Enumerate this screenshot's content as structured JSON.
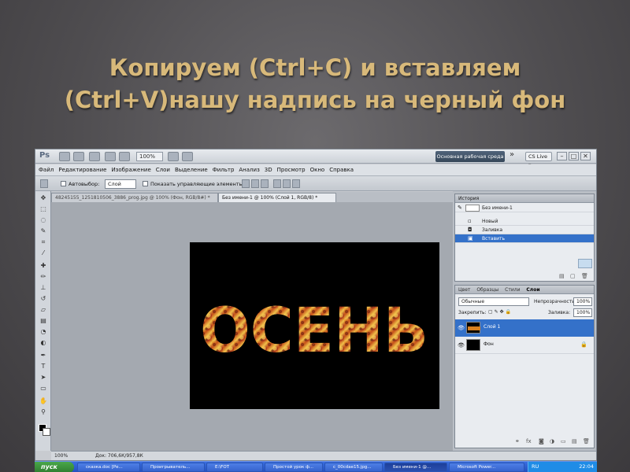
{
  "slide": {
    "title_line1": "Копируем (Ctrl+C) и вставляем",
    "title_line2": "(Ctrl+V)нашу надпись на черный фон"
  },
  "app": {
    "logo": "Ps",
    "zoom": "100%",
    "workspace": "Основная рабочая среда",
    "expand": "»",
    "cs_live": "CS Live ▾",
    "window_buttons": [
      "–",
      "□",
      "✕"
    ]
  },
  "menu": [
    "Файл",
    "Редактирование",
    "Изображение",
    "Слои",
    "Выделение",
    "Фильтр",
    "Анализ",
    "3D",
    "Просмотр",
    "Окно",
    "Справка"
  ],
  "options": {
    "auto_select_label": "Автовыбор:",
    "auto_select_value": "Слой",
    "show_controls_label": "Показать управляющие элементы"
  },
  "tabs": [
    {
      "label": "48245155_1251810506_3886_prog.jpg @ 100% (Фон, RGB/8#) *",
      "active": false
    },
    {
      "label": "Без имени-1 @ 100% (Слой 1, RGB/8) *",
      "active": true
    }
  ],
  "canvas": {
    "word": "ОСЕНЬ",
    "background": "#000000"
  },
  "status": {
    "zoom": "100%",
    "doc_size": "Док: 706,6К/957,8К"
  },
  "history": {
    "header": "История",
    "items": [
      {
        "label": "Без имени-1",
        "kind": "snapshot",
        "selected": false
      },
      {
        "label": "Новый",
        "kind": "step",
        "selected": false
      },
      {
        "label": "Заливка",
        "kind": "step",
        "selected": false
      },
      {
        "label": "Вставить",
        "kind": "step",
        "selected": true
      }
    ]
  },
  "layers": {
    "tabs": [
      "Цвет",
      "Образцы",
      "Стили",
      "Слои"
    ],
    "blend_mode": "Обычные",
    "opacity_label": "Непрозрачность:",
    "opacity_value": "100%",
    "lock_label": "Закрепить:",
    "fill_label": "Заливка:",
    "fill_value": "100%",
    "items": [
      {
        "name": "Слой 1",
        "selected": true
      },
      {
        "name": "Фон",
        "selected": false
      }
    ]
  },
  "taskbar": {
    "start": "пуск",
    "items": [
      "сказка.doc [Ре...",
      "Проигрыватель...",
      "E:\\FOT",
      "Простой урок ф...",
      "c_00cdae15.jpg...",
      "Без имени-1 @...",
      "Microsoft Power..."
    ],
    "active_index": 5,
    "lang": "RU",
    "clock": "22:04"
  },
  "colors": {
    "title": "#d8b97a",
    "selection": "#3471c9",
    "canvas_bg": "#000000"
  }
}
